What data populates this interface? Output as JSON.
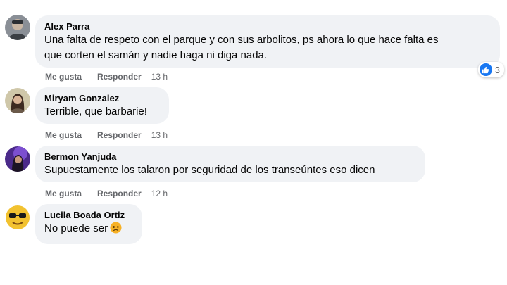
{
  "comments": [
    {
      "author": "Alex Parra",
      "text_lines": [
        "Una falta de respeto con el parque y con sus arbolitos, ps ahora lo que hace falta es",
        "que corten el samán y nadie haga ni diga nada."
      ],
      "like_label": "Me gusta",
      "reply_label": "Responder",
      "time": "13 h",
      "reaction": {
        "icon": "like-icon",
        "count": "3",
        "color": "#1877f2"
      }
    },
    {
      "author": "Miryam Gonzalez",
      "text": "Terrible, que barbarie!",
      "like_label": "Me gusta",
      "reply_label": "Responder",
      "time": "13 h"
    },
    {
      "author": "Bermon Yanjuda",
      "text": "Supuestamente los talaron por seguridad de los transeúntes eso dicen",
      "like_label": "Me gusta",
      "reply_label": "Responder",
      "time": "12 h"
    },
    {
      "author": "Lucila Boada Ortiz",
      "text": "No puede ser",
      "emoji": "sad-face-emoji"
    }
  ],
  "colors": {
    "bubble_bg": "#f0f2f5",
    "meta_text": "#65676b",
    "reaction_blue": "#1877f2"
  }
}
